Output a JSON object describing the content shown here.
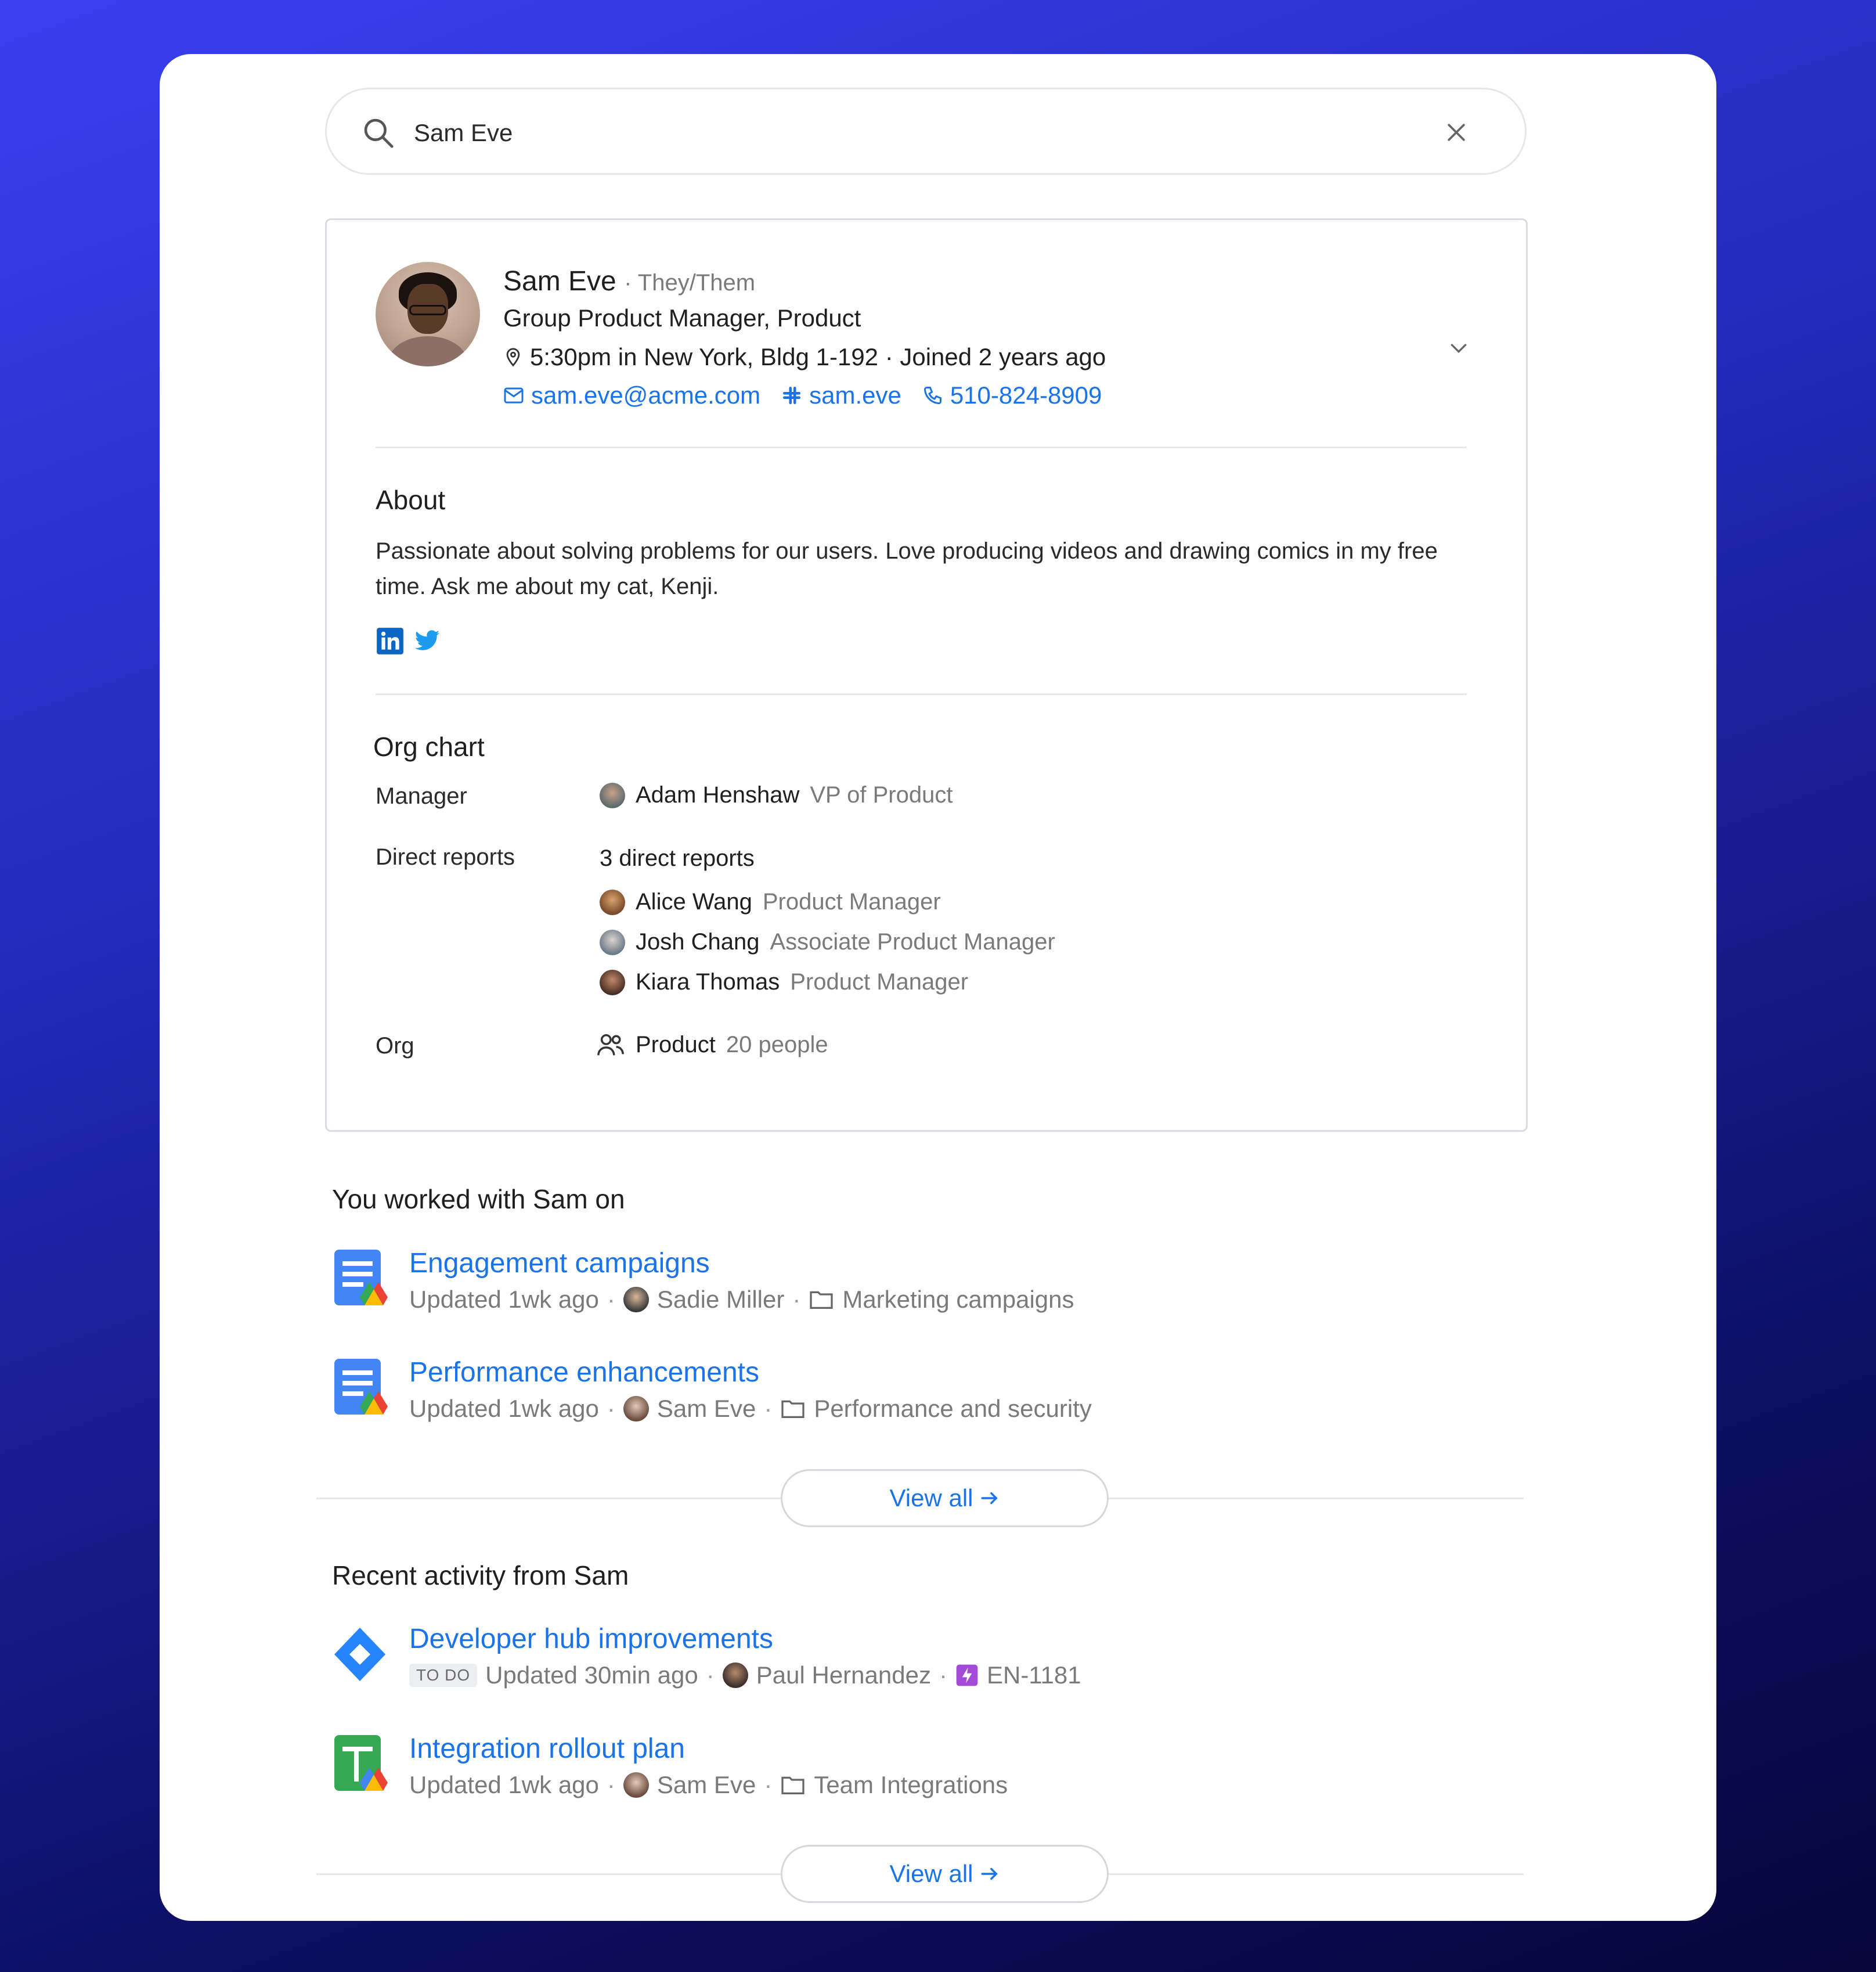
{
  "search": {
    "query": "Sam Eve"
  },
  "profile": {
    "name": "Sam Eve",
    "pronouns": "· They/Them",
    "title": "Group Product Manager, Product",
    "location": "5:30pm in New York, Bldg 1-192 · Joined 2 years ago",
    "email": "sam.eve@acme.com",
    "slack": "sam.eve",
    "phone": "510-824-8909"
  },
  "about": {
    "heading": "About",
    "text": "Passionate about solving problems for our users. Love producing videos and drawing comics in my free time. Ask me about my cat, Kenji."
  },
  "org": {
    "heading": "Org chart",
    "manager_label": "Manager",
    "manager": {
      "name": "Adam Henshaw",
      "role": "VP of Product"
    },
    "reports_label": "Direct reports",
    "reports_count": "3 direct reports",
    "reports": [
      {
        "name": "Alice Wang",
        "role": "Product Manager"
      },
      {
        "name": "Josh Chang",
        "role": "Associate Product Manager"
      },
      {
        "name": "Kiara Thomas",
        "role": "Product Manager"
      }
    ],
    "org_label": "Org",
    "org_name": "Product",
    "org_size": "20 people"
  },
  "worked_with": {
    "heading": "You worked with Sam on",
    "items": [
      {
        "title": "Engagement campaigns",
        "updated": "Updated 1wk ago",
        "person": "Sadie Miller",
        "folder": "Marketing campaigns"
      },
      {
        "title": "Performance enhancements",
        "updated": "Updated 1wk ago",
        "person": "Sam Eve",
        "folder": "Performance and security"
      }
    ],
    "view_all": "View all"
  },
  "recent": {
    "heading": "Recent activity from Sam",
    "items": [
      {
        "title": "Developer hub improvements",
        "badge": "TO DO",
        "updated": "Updated 30min ago",
        "person": "Paul Hernandez",
        "ticket": "EN-1181"
      },
      {
        "title": "Integration rollout plan",
        "updated": "Updated 1wk ago",
        "person": "Sam Eve",
        "folder": "Team Integrations"
      }
    ],
    "view_all": "View all"
  },
  "colors": {
    "accent": "#1a73e8",
    "background_gradient_start": "#3a3ff0",
    "background_gradient_end": "#06063a"
  }
}
